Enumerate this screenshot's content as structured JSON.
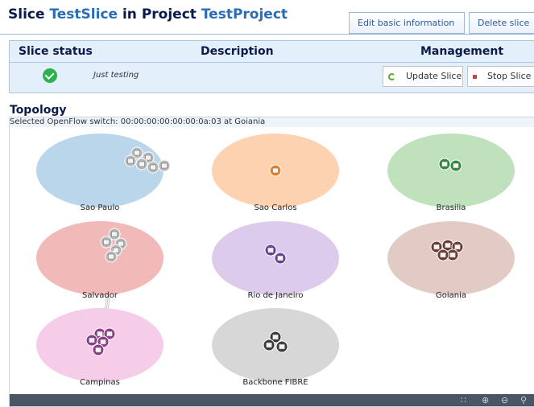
{
  "header": {
    "title_prefix": "Slice",
    "slice_name": "TestSlice",
    "title_middle": "in Project",
    "project_name": "TestProject",
    "edit_button": "Edit basic information",
    "delete_button": "Delete slice"
  },
  "status_table": {
    "headers": {
      "status": "Slice status",
      "description": "Description",
      "management": "Management"
    },
    "status_icon": "check-circle-icon",
    "description": "Just testing",
    "update_button": "Update Slice",
    "stop_button": "Stop Slice"
  },
  "topology": {
    "title": "Topology",
    "selected_info": "Selected OpenFlow switch: 00:00:00:00:00:00:0a:03 at Goiania",
    "islands": [
      {
        "name": "Sao Paulo",
        "color": "#b9d6ea",
        "switch_color": "#b5b5b5",
        "switches": 6
      },
      {
        "name": "Sao Carlos",
        "color": "#fdd2b0",
        "switch_color": "#f0821e",
        "switches": 1
      },
      {
        "name": "Brasilia",
        "color": "#bfe2bd",
        "switch_color": "#2f8a3a",
        "switches": 2
      },
      {
        "name": "Salvador",
        "color": "#f2b9b9",
        "switch_color": "#b5b5b5",
        "switches": 5
      },
      {
        "name": "Rio de Janeiro",
        "color": "#dccbea",
        "switch_color": "#6a3f9a",
        "switches": 2
      },
      {
        "name": "Goiania",
        "color": "#e2cbc5",
        "switch_color": "#6e3a2f",
        "switches": 5
      },
      {
        "name": "Campinas",
        "color": "#f5cde8",
        "switch_color": "#93378a",
        "switches": 5
      },
      {
        "name": "Backbone FIBRE",
        "color": "#d7d7d7",
        "switch_color": "#3a3a3a",
        "switches": 3
      }
    ],
    "controls": {
      "fit_icon": "fit-to-screen-icon",
      "zoom_in_icon": "zoom-in-icon",
      "zoom_out_icon": "zoom-out-icon",
      "reset_icon": "zoom-reset-icon"
    }
  }
}
